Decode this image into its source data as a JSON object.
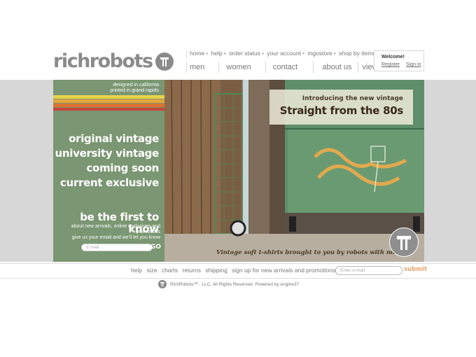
{
  "header": {
    "logo_text": "richrobots",
    "top_links": [
      "home",
      "help",
      "order status",
      "your account",
      "mgostore",
      "shop by item#"
    ],
    "main_nav": [
      "men",
      "women",
      "contact",
      "about us",
      "view cart"
    ],
    "welcome": {
      "title": "Welcome!",
      "register": "Register",
      "signin": "Sign in"
    }
  },
  "left_panel": {
    "tagline1": "designed in california",
    "tagline2": "printed in grand rapids",
    "stripe_colors": [
      "#e8d44a",
      "#e6a43a",
      "#d9722e",
      "#c9443a"
    ],
    "headline_lines": [
      "original vintage",
      "university vintage",
      "coming soon",
      "current exclusive"
    ],
    "cta_title": "be the first to know",
    "cta_lines": [
      "about new arrivals, online exclusives,and",
      "promotions",
      "give us your email and we'll let you know"
    ],
    "email_placeholder": "E-mail",
    "go_label": "GO"
  },
  "hero": {
    "line1": "Introducing the new vintage",
    "line2": "Straight from the 80s",
    "caption": "Vintage soft t-shirts brought to you by robots with means."
  },
  "footer": {
    "links": [
      "help",
      "size",
      "charts",
      "returns",
      "shipping"
    ],
    "signup_text": "sign up  for new arrivals and promotions",
    "email_placeholder": "Enter e-mail",
    "submit_label": "submit",
    "copyright": "RichRobots™ , LLC, All Rights Reserved. Powered by engine37"
  },
  "colors": {
    "panel_green": "#7a9672",
    "gray_band": "#d7d7d7",
    "submit_orange": "#e5a46a"
  }
}
